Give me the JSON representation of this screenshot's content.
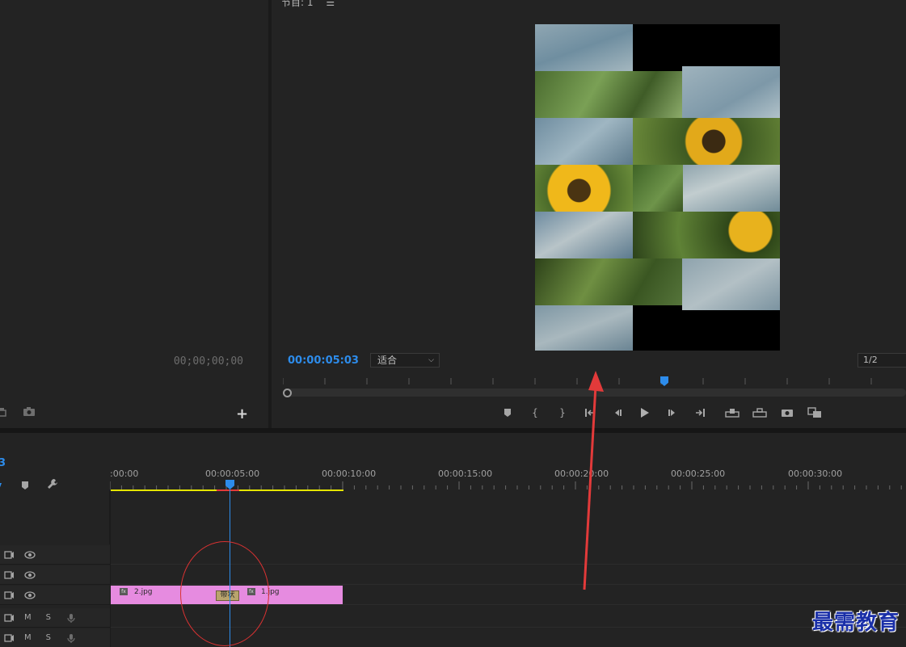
{
  "source_monitor": {
    "timecode": "00;00;00;00",
    "add_symbol": "+"
  },
  "program_monitor": {
    "title_prefix": "节目:",
    "title_sequence": "1",
    "timecode": "00:00:05:03",
    "fit_label": "适合",
    "resolution_label": "1/2"
  },
  "timeline": {
    "timecode_fragment": "3",
    "tick_labels": [
      ":00:00",
      "00:00:05:00",
      "00:00:10:00",
      "00:00:15:00",
      "00:00:20:00",
      "00:00:25:00",
      "00:00:30:00"
    ],
    "tracks": [
      {
        "type": "video"
      },
      {
        "type": "video"
      },
      {
        "type": "video"
      },
      {
        "type": "audio",
        "m_label": "M",
        "s_label": "S"
      },
      {
        "type": "audio",
        "m_label": "M",
        "s_label": "S"
      }
    ],
    "clips": [
      {
        "name": "2.jpg",
        "fx": "fx"
      },
      {
        "name": "1.jpg",
        "fx": "fx"
      }
    ],
    "transition_label": "带状"
  },
  "watermark": "最需教育",
  "colors": {
    "accent_blue": "#2d8ceb",
    "clip_pink": "#e68be0",
    "workarea_yellow": "#e5e500",
    "annotation_red": "#d93232"
  },
  "icons": {
    "source_bottom": [
      "export-frame-icon",
      "camera-icon"
    ],
    "transport": [
      "marker-icon",
      "mark-in-icon",
      "mark-out-icon",
      "go-to-in-icon",
      "step-back-icon",
      "play-icon",
      "step-forward-icon",
      "go-to-out-icon",
      "insert-icon",
      "overwrite-icon",
      "export-frame-icon",
      "compare-icon"
    ]
  }
}
